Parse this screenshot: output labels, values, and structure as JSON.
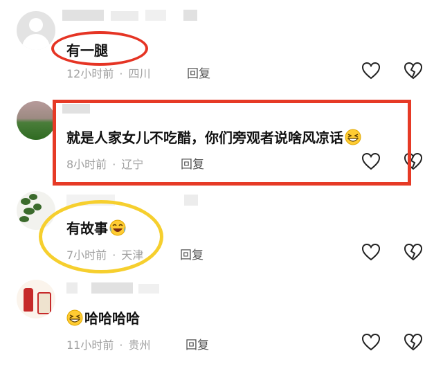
{
  "comments": [
    {
      "content": "有一腿",
      "time": "12小时前",
      "location": "四川",
      "reply_label": "回复",
      "avatar_icon": "default-user-avatar"
    },
    {
      "content": "就是人家女儿不吃醋，你们旁观者说啥风凉话",
      "emoji": "grinning-squint-emoji",
      "time": "8小时前",
      "location": "辽宁",
      "reply_label": "回复",
      "avatar_icon": "field-landscape-avatar"
    },
    {
      "content": "有故事",
      "emoji": "laughing-tears-emoji",
      "time": "7小时前",
      "location": "天津",
      "reply_label": "回复",
      "avatar_icon": "plant-avatar"
    },
    {
      "content": "哈哈哈哈",
      "emoji": "grinning-squint-emoji",
      "time": "11小时前",
      "location": "贵州",
      "reply_label": "回复",
      "avatar_icon": "liquor-bottle-avatar"
    }
  ],
  "separator": "·",
  "colors": {
    "highlight_red": "#e53424",
    "highlight_yellow": "#f6cf2e",
    "meta_text": "#a0a0a0",
    "content_text": "#111111"
  }
}
